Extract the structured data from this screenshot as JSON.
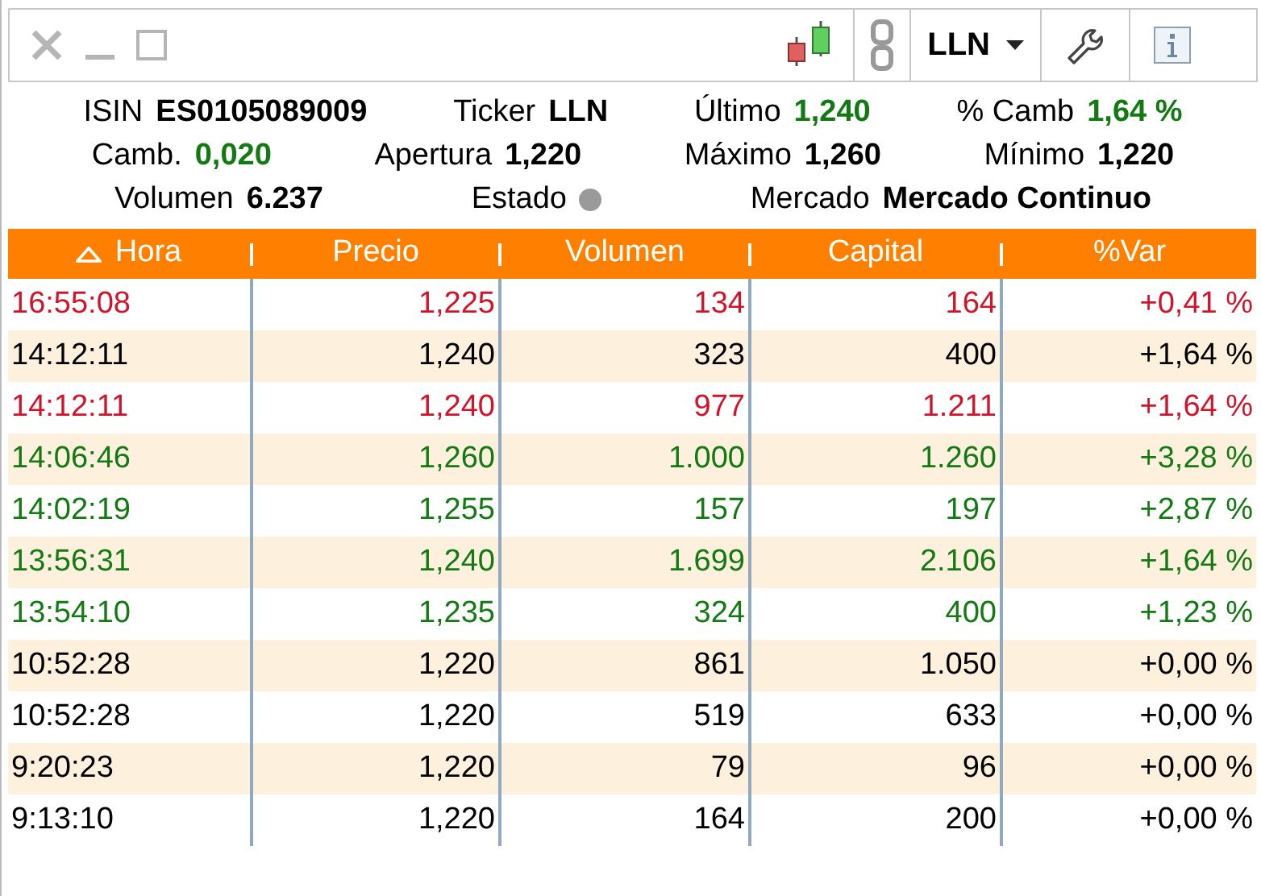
{
  "toolbar": {
    "symbol": "LLN"
  },
  "info": [
    [
      {
        "label": "ISIN",
        "value": "ES0105089009",
        "kind": "plain"
      },
      {
        "label": "Ticker",
        "value": "LLN",
        "kind": "plain"
      },
      {
        "label": "Último",
        "value": "1,240",
        "kind": "up"
      },
      {
        "label": "% Camb",
        "value": "1,64 %",
        "kind": "up"
      }
    ],
    [
      {
        "label": "Camb.",
        "value": "0,020",
        "kind": "up"
      },
      {
        "label": "Apertura",
        "value": "1,220",
        "kind": "plain"
      },
      {
        "label": "Máximo",
        "value": "1,260",
        "kind": "plain"
      },
      {
        "label": "Mínimo",
        "value": "1,220",
        "kind": "plain"
      }
    ],
    [
      {
        "label": "Volumen",
        "value": "6.237",
        "kind": "plain"
      },
      {
        "label": "Estado",
        "kind": "dot"
      },
      {
        "label": "Mercado",
        "value": "Mercado Continuo",
        "kind": "plain"
      }
    ]
  ],
  "table": {
    "columns": [
      {
        "label": "Hora",
        "sorted": true
      },
      {
        "label": "Precio",
        "sorted": false
      },
      {
        "label": "Volumen",
        "sorted": false
      },
      {
        "label": "Capital",
        "sorted": false
      },
      {
        "label": "%Var",
        "sorted": false
      }
    ],
    "rows": [
      {
        "kind": "down",
        "cells": [
          "16:55:08",
          "1,225",
          "134",
          "164",
          "+0,41 %"
        ]
      },
      {
        "kind": "flat",
        "cells": [
          "14:12:11",
          "1,240",
          "323",
          "400",
          "+1,64 %"
        ]
      },
      {
        "kind": "down",
        "cells": [
          "14:12:11",
          "1,240",
          "977",
          "1.211",
          "+1,64 %"
        ]
      },
      {
        "kind": "up",
        "cells": [
          "14:06:46",
          "1,260",
          "1.000",
          "1.260",
          "+3,28 %"
        ]
      },
      {
        "kind": "up",
        "cells": [
          "14:02:19",
          "1,255",
          "157",
          "197",
          "+2,87 %"
        ]
      },
      {
        "kind": "up",
        "cells": [
          "13:56:31",
          "1,240",
          "1.699",
          "2.106",
          "+1,64 %"
        ]
      },
      {
        "kind": "up",
        "cells": [
          "13:54:10",
          "1,235",
          "324",
          "400",
          "+1,23 %"
        ]
      },
      {
        "kind": "flat",
        "cells": [
          "10:52:28",
          "1,220",
          "861",
          "1.050",
          "+0,00 %"
        ]
      },
      {
        "kind": "flat",
        "cells": [
          "10:52:28",
          "1,220",
          "519",
          "633",
          "+0,00 %"
        ]
      },
      {
        "kind": "flat",
        "cells": [
          "9:20:23",
          "1,220",
          "79",
          "96",
          "+0,00 %"
        ]
      },
      {
        "kind": "flat",
        "cells": [
          "9:13:10",
          "1,220",
          "164",
          "200",
          "+0,00 %"
        ]
      }
    ]
  }
}
